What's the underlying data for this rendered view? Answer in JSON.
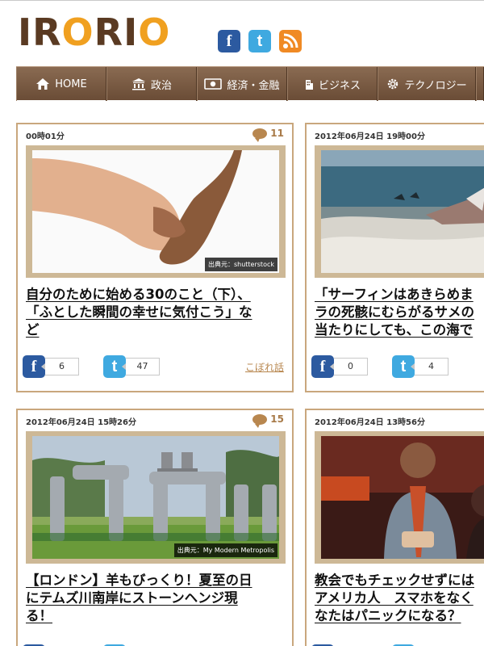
{
  "site": {
    "logo": "IRORIO",
    "colors": {
      "brown": "#5a3a22",
      "orange": "#f0a020",
      "nav": "#7a5c44",
      "frame": "#c9a77d",
      "facebook": "#2c5aa0",
      "twitter": "#3fa9e0",
      "rss": "#f08a24"
    }
  },
  "header_social": [
    {
      "icon": "facebook-icon",
      "glyph": "f"
    },
    {
      "icon": "twitter-icon",
      "glyph": "t"
    },
    {
      "icon": "rss-icon",
      "glyph": ""
    }
  ],
  "nav": {
    "items": [
      {
        "label": "HOME",
        "icon": "home-icon"
      },
      {
        "label": "政治",
        "icon": "government-icon"
      },
      {
        "label": "経済・金融",
        "icon": "money-icon"
      },
      {
        "label": "ビジネス",
        "icon": "building-icon"
      },
      {
        "label": "テクノロジー",
        "icon": "gear-icon"
      }
    ]
  },
  "articles": [
    {
      "date": "00時01分",
      "comments": "11",
      "caption": "出典元：shutterstock",
      "title_lines": [
        "自分のために始める30のこと（下）、",
        "「ふとした瞬間の幸せに気付こう」な",
        "ど"
      ],
      "fb_count": "6",
      "tw_count": "47",
      "extra_link": "こぼれ話"
    },
    {
      "date": "2012年06月24日 19時00分",
      "comments": "",
      "caption": "",
      "title_lines": [
        "「サーフィンはあきらめま",
        "ラの死骸にむらがるサメの",
        "当たりにしても、この海で"
      ],
      "fb_count": "0",
      "tw_count": "4",
      "extra_link": ""
    },
    {
      "date": "2012年06月24日 15時26分",
      "comments": "15",
      "caption": "出典元：My Modern Metropolis",
      "title_lines": [
        "【ロンドン】羊もびっくり！夏至の日",
        "にテムズ川南岸にストーンヘンジ現",
        "る！"
      ],
      "fb_count": "",
      "tw_count": "",
      "extra_link": ""
    },
    {
      "date": "2012年06月24日 13時56分",
      "comments": "",
      "caption": "",
      "title_lines": [
        "教会でもチェックせずには",
        "アメリカ人　スマホをなく",
        "なたはパニックになる？"
      ],
      "fb_count": "",
      "tw_count": "",
      "extra_link": ""
    }
  ]
}
